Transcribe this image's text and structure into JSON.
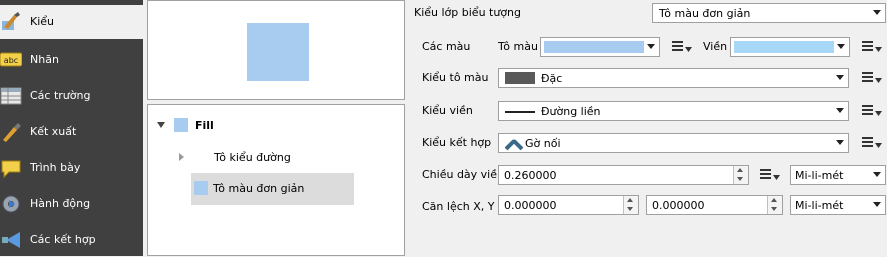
{
  "nav": {
    "items": [
      {
        "label": "Kiểu",
        "icon": "paintbrush-style-icon"
      },
      {
        "label": "Nhãn",
        "icon": "abc-label-icon"
      },
      {
        "label": "Các trường",
        "icon": "table-fields-icon"
      },
      {
        "label": "Kết xuất",
        "icon": "render-brush-icon"
      },
      {
        "label": "Trình bày",
        "icon": "speech-bubble-icon"
      },
      {
        "label": "Hành động",
        "icon": "gear-action-icon"
      },
      {
        "label": "Các kết hợp",
        "icon": "join-arrow-icon"
      }
    ]
  },
  "tree": {
    "root_label": "Fill",
    "children": [
      {
        "label": "Tô kiểu đường"
      },
      {
        "label": "Tô màu đơn giản"
      }
    ]
  },
  "form": {
    "symbol_layer_type_label": "Kiểu lớp biểu tượng",
    "symbol_layer_type_value": "Tô màu đơn giản",
    "colors_label": "Các màu",
    "fill_label": "Tô màu",
    "fill_color": "#a8ccf0",
    "border_label": "Viền",
    "border_color": "#a8d8f8",
    "fill_style_label": "Kiểu tô màu",
    "fill_style_value": "Đặc",
    "border_style_label": "Kiểu viền",
    "border_style_value": "Đường liền",
    "join_style_label": "Kiểu kết hợp",
    "join_style_value": "Gờ nối",
    "border_width_label": "Chiều dày viền",
    "border_width_value": "0.260000",
    "border_width_unit": "Mi-li-mét",
    "offset_label": "Căn lệch X, Y",
    "offset_x": "0.000000",
    "offset_y": "0.000000",
    "offset_unit": "Mi-li-mét"
  },
  "colors": {
    "nav_bg": "#404040",
    "swatch": "#a8ccf0"
  }
}
